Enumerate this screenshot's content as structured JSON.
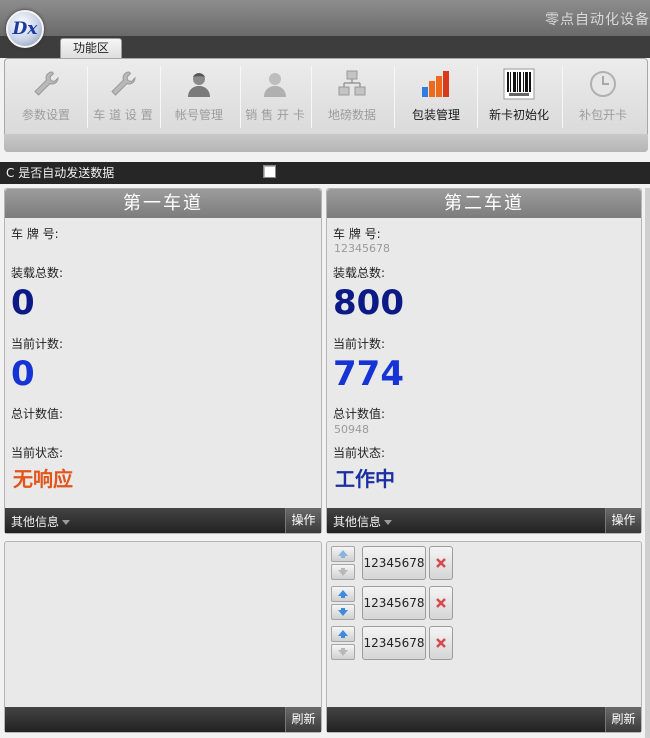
{
  "app": {
    "title": "零点自动化设备",
    "logo_text": "Dx",
    "tab_label": "功能区"
  },
  "ribbon": {
    "buttons": [
      {
        "label": "参数设置",
        "icon": "wrench-icon",
        "enabled": false
      },
      {
        "label": "车 道 设 置",
        "icon": "wrench-icon",
        "enabled": false
      },
      {
        "label": "帐号管理",
        "icon": "user-icon",
        "enabled": false
      },
      {
        "label": "销 售 开 卡",
        "icon": "user-icon",
        "enabled": false
      },
      {
        "label": "地磅数据",
        "icon": "network-icon",
        "enabled": false
      },
      {
        "label": "包装管理",
        "icon": "bar-chart-icon",
        "enabled": true
      },
      {
        "label": "新卡初始化",
        "icon": "barcode-icon",
        "enabled": true
      },
      {
        "label": "补包开卡",
        "icon": "clock-icon",
        "enabled": false
      }
    ]
  },
  "auto_send": {
    "label": "是否自动发送数据",
    "prefix": "C",
    "checked": false
  },
  "lanes": [
    {
      "title": "第一车道",
      "plate_label": "车 牌 号:",
      "plate_value": "",
      "load_total_label": "装载总数:",
      "load_total": "0",
      "current_count_label": "当前计数:",
      "current_count": "0",
      "total_count_label": "总计数值:",
      "total_count": "",
      "status_label": "当前状态:",
      "status": "无响应",
      "status_color": "#e2541a",
      "info_label": "其他信息",
      "action_label": "操作"
    },
    {
      "title": "第二车道",
      "plate_label": "车 牌 号:",
      "plate_value": "12345678",
      "load_total_label": "装载总数:",
      "load_total": "800",
      "current_count_label": "当前计数:",
      "current_count": "774",
      "total_count_label": "总计数值:",
      "total_count": "50948",
      "status_label": "当前状态:",
      "status": "工作中",
      "status_color": "#1a2fa0",
      "info_label": "其他信息",
      "action_label": "操作"
    }
  ],
  "colors": {
    "load_total": "#0d1a86",
    "current_count": "#1633d6"
  },
  "queues": [
    {
      "refresh_label": "刷新",
      "items": []
    },
    {
      "refresh_label": "刷新",
      "items": [
        "12345678",
        "12345678",
        "12345678"
      ]
    }
  ]
}
